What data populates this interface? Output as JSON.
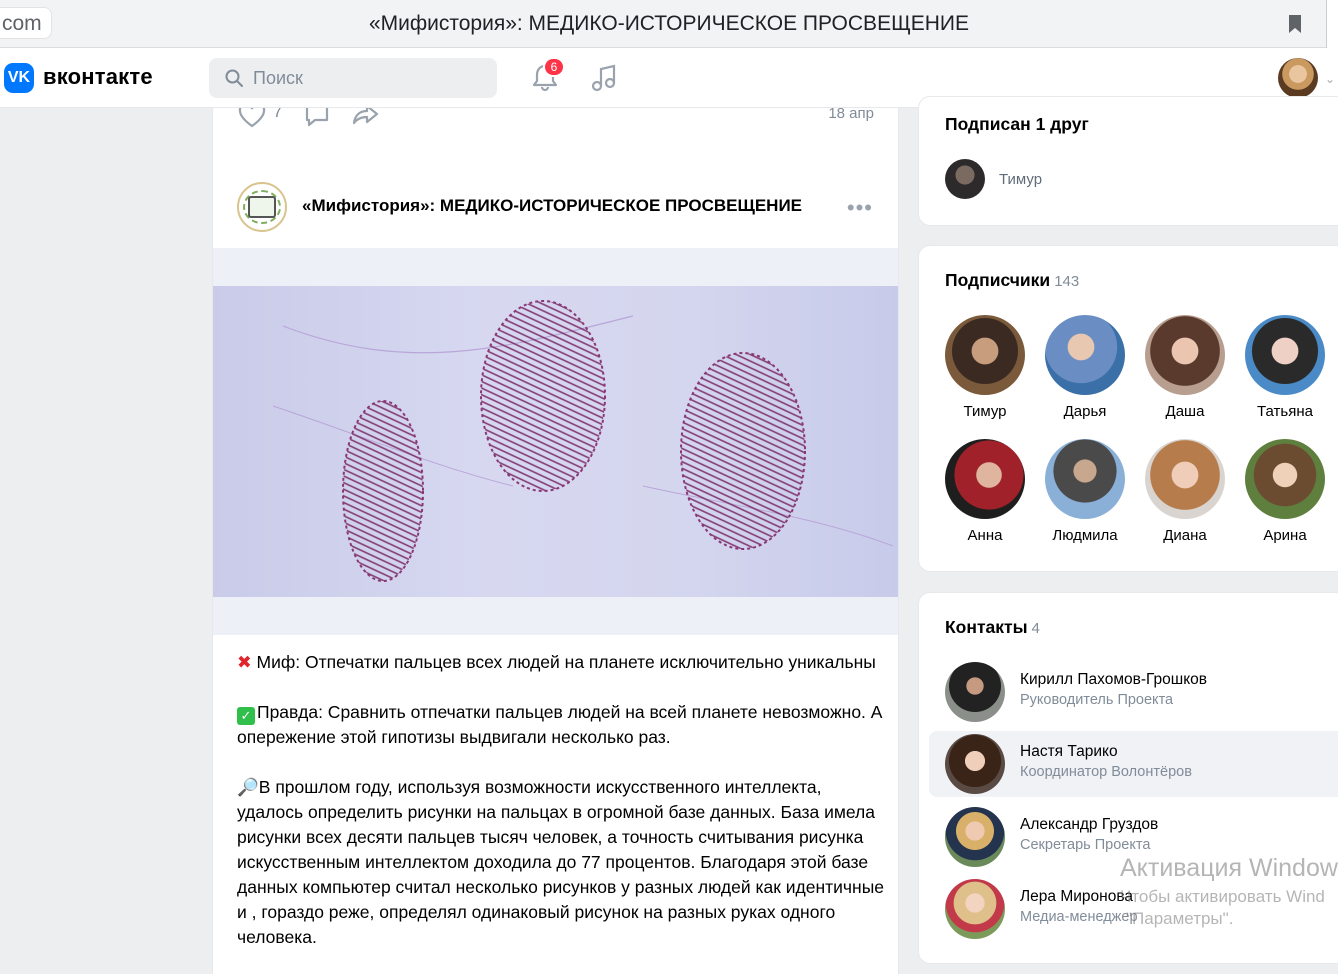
{
  "browser": {
    "url_fragment": "com",
    "tab_title": "«Мифистория»: МЕДИКО-ИСТОРИЧЕСКОЕ ПРОСВЕЩЕНИЕ"
  },
  "header": {
    "brand": "вконтакте",
    "logo_text": "VK",
    "search_placeholder": "Поиск",
    "notifications_count": "6",
    "accent": "#0077ff",
    "badge_color": "#ff3347"
  },
  "previous_post": {
    "likes": "7",
    "date": "18 апр"
  },
  "post": {
    "group_name": "«Мифистория»: МЕДИКО-ИСТОРИЧЕСКОЕ ПРОСВЕЩЕНИЕ",
    "more": "•••",
    "myth": "Миф: Отпечатки пальцев всех людей на планете исключительно уникальны",
    "truth": "Правда: Сравнить отпечатки пальцев людей на всей планете невозможно. А опережение этой гипотизы выдвигали несколько раз.",
    "details": "В прошлом году, используя возможности искусственного интеллекта, удалось определить рисунки на пальцах в огромной базе данных. База имела рисунки всех десяти пальцев тысяч человек, а точность считывания рисунка искусственным интеллектом доходила до 77 процентов. Благодаря этой базе данных компьютер считал несколько рисунков у разных людей как идентичные и , гораздо реже, определял одинаковый рисунок на разных руках одного человека."
  },
  "friends": {
    "title": "Подписан 1 друг",
    "items": [
      {
        "name": "Тимур"
      }
    ]
  },
  "followers": {
    "title": "Подписчики",
    "count": "143",
    "items": [
      {
        "name": "Тимур"
      },
      {
        "name": "Дарья"
      },
      {
        "name": "Даша"
      },
      {
        "name": "Татьяна"
      },
      {
        "name": "Анна"
      },
      {
        "name": "Людмила"
      },
      {
        "name": "Диана"
      },
      {
        "name": "Арина"
      }
    ]
  },
  "contacts": {
    "title": "Контакты",
    "count": "4",
    "items": [
      {
        "name": "Кирилл Пахомов-Грошков",
        "role": "Руководитель Проекта"
      },
      {
        "name": "Настя Тарико",
        "role": "Координатор Волонтёров"
      },
      {
        "name": "Александр Груздов",
        "role": "Секретарь Проекта"
      },
      {
        "name": "Лера Миронова",
        "role": "Медиа-менеджер"
      }
    ]
  },
  "watermark": {
    "line1": "Активация Window",
    "line2": "Чтобы активировать Wind",
    "line3": "\"Параметры\"."
  }
}
